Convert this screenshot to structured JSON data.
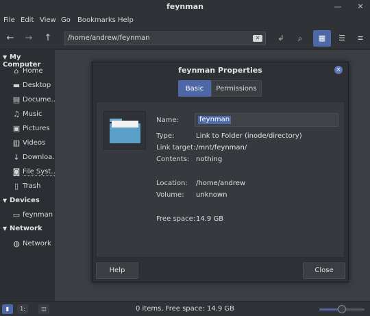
{
  "window": {
    "title": "feynman",
    "minimize_icon": "minimize-icon",
    "close_icon": "close-icon"
  },
  "menu": [
    "File",
    "Edit",
    "View",
    "Go",
    "Bookmarks",
    "Help"
  ],
  "toolbar": {
    "path": "/home/andrew/feynman",
    "icons": [
      "back-icon",
      "forward-icon",
      "up-icon",
      "clear-icon",
      "edit-location-icon",
      "search-icon",
      "icon-view-icon",
      "list-view-icon",
      "compact-view-icon"
    ]
  },
  "sidebar": {
    "sections": [
      {
        "title": "My Computer",
        "items": [
          {
            "label": "Home",
            "icon": "home-icon"
          },
          {
            "label": "Desktop",
            "icon": "desktop-icon"
          },
          {
            "label": "Docume…",
            "icon": "documents-icon"
          },
          {
            "label": "Music",
            "icon": "music-icon"
          },
          {
            "label": "Pictures",
            "icon": "pictures-icon"
          },
          {
            "label": "Videos",
            "icon": "videos-icon"
          },
          {
            "label": "Downloa…",
            "icon": "downloads-icon"
          },
          {
            "label": "File Syst…",
            "icon": "filesystem-icon"
          },
          {
            "label": "Trash",
            "icon": "trash-icon"
          }
        ]
      },
      {
        "title": "Devices",
        "items": [
          {
            "label": "feynman",
            "icon": "drive-icon"
          }
        ]
      },
      {
        "title": "Network",
        "items": [
          {
            "label": "Network",
            "icon": "network-icon"
          }
        ]
      }
    ]
  },
  "dialog": {
    "title": "feynman Properties",
    "tabs": [
      "Basic",
      "Permissions"
    ],
    "active_tab": "Basic",
    "properties": {
      "name_label": "Name:",
      "name_value": "feynman",
      "type_label": "Type:",
      "type_value": "Link to Folder (inode/directory)",
      "link_target_label": "Link target:",
      "link_target_value": "/mnt/feynman/",
      "contents_label": "Contents:",
      "contents_value": "nothing",
      "location_label": "Location:",
      "location_value": "/home/andrew",
      "volume_label": "Volume:",
      "volume_value": "unknown",
      "free_space_label": "Free space:",
      "free_space_value": "14.9 GB"
    },
    "help_button": "Help",
    "close_button": "Close"
  },
  "statusbar": {
    "text": "0 items, Free space: 14.9 GB",
    "zoom_level": 0.5
  },
  "colors": {
    "accent": "#4e67a6",
    "folder": "#5aa0c9"
  }
}
